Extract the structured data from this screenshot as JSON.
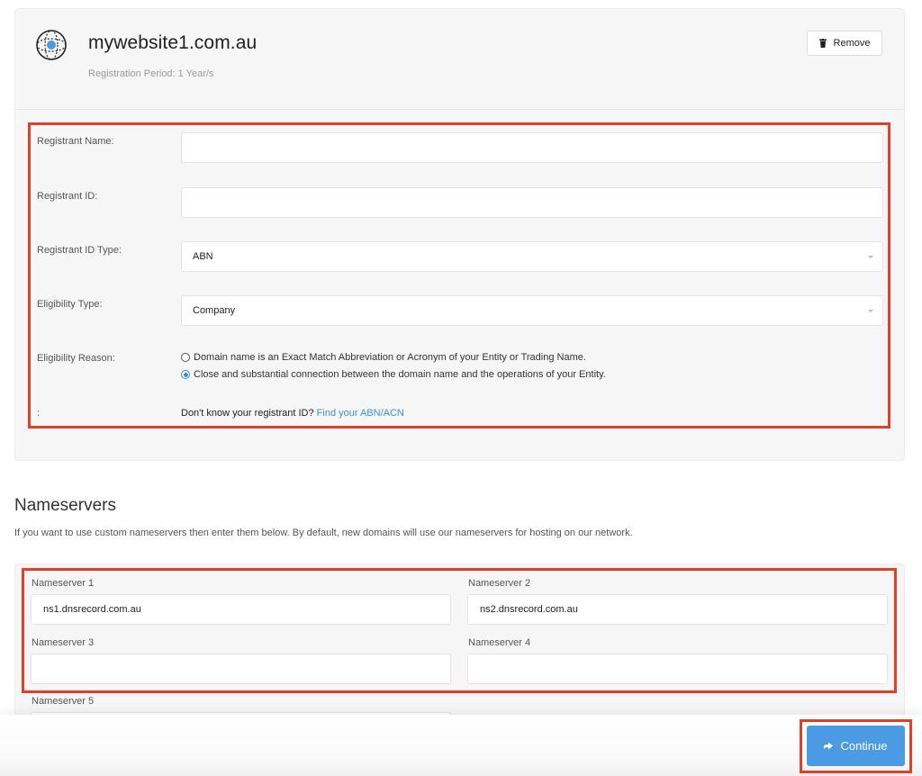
{
  "domain": {
    "name": "mywebsite1.com.au",
    "registration_period": "Registration Period: 1 Year/s",
    "remove_label": "Remove",
    "icon": "globe-icon"
  },
  "fields": {
    "registrant_name": {
      "label": "Registrant Name:",
      "value": ""
    },
    "registrant_id": {
      "label": "Registrant ID:",
      "value": ""
    },
    "registrant_id_type": {
      "label": "Registrant ID Type:",
      "value": "ABN"
    },
    "eligibility_type": {
      "label": "Eligibility Type:",
      "value": "Company"
    },
    "eligibility_reason": {
      "label": "Eligibility Reason:",
      "options": [
        {
          "label": "Domain name is an Exact Match Abbreviation or Acronym of your Entity or Trading Name.",
          "checked": false
        },
        {
          "label": "Close and substantial connection between the domain name and the operations of your Entity.",
          "checked": true
        }
      ]
    },
    "help": {
      "label": ":",
      "text": "Don't know your registrant ID?",
      "link": "Find your ABN/ACN"
    }
  },
  "nameservers": {
    "title": "Nameservers",
    "description": "If you want to use custom nameservers then enter them below. By default, new domains will use our nameservers for hosting on our network.",
    "items": [
      {
        "label": "Nameserver 1",
        "value": "ns1.dnsrecord.com.au"
      },
      {
        "label": "Nameserver 2",
        "value": "ns2.dnsrecord.com.au"
      },
      {
        "label": "Nameserver 3",
        "value": ""
      },
      {
        "label": "Nameserver 4",
        "value": ""
      },
      {
        "label": "Nameserver 5",
        "value": ""
      }
    ]
  },
  "actions": {
    "continue_label": "Continue"
  },
  "colors": {
    "accent": "#4a9be3",
    "highlight": "#e0402a",
    "link": "#3a8fe0"
  }
}
